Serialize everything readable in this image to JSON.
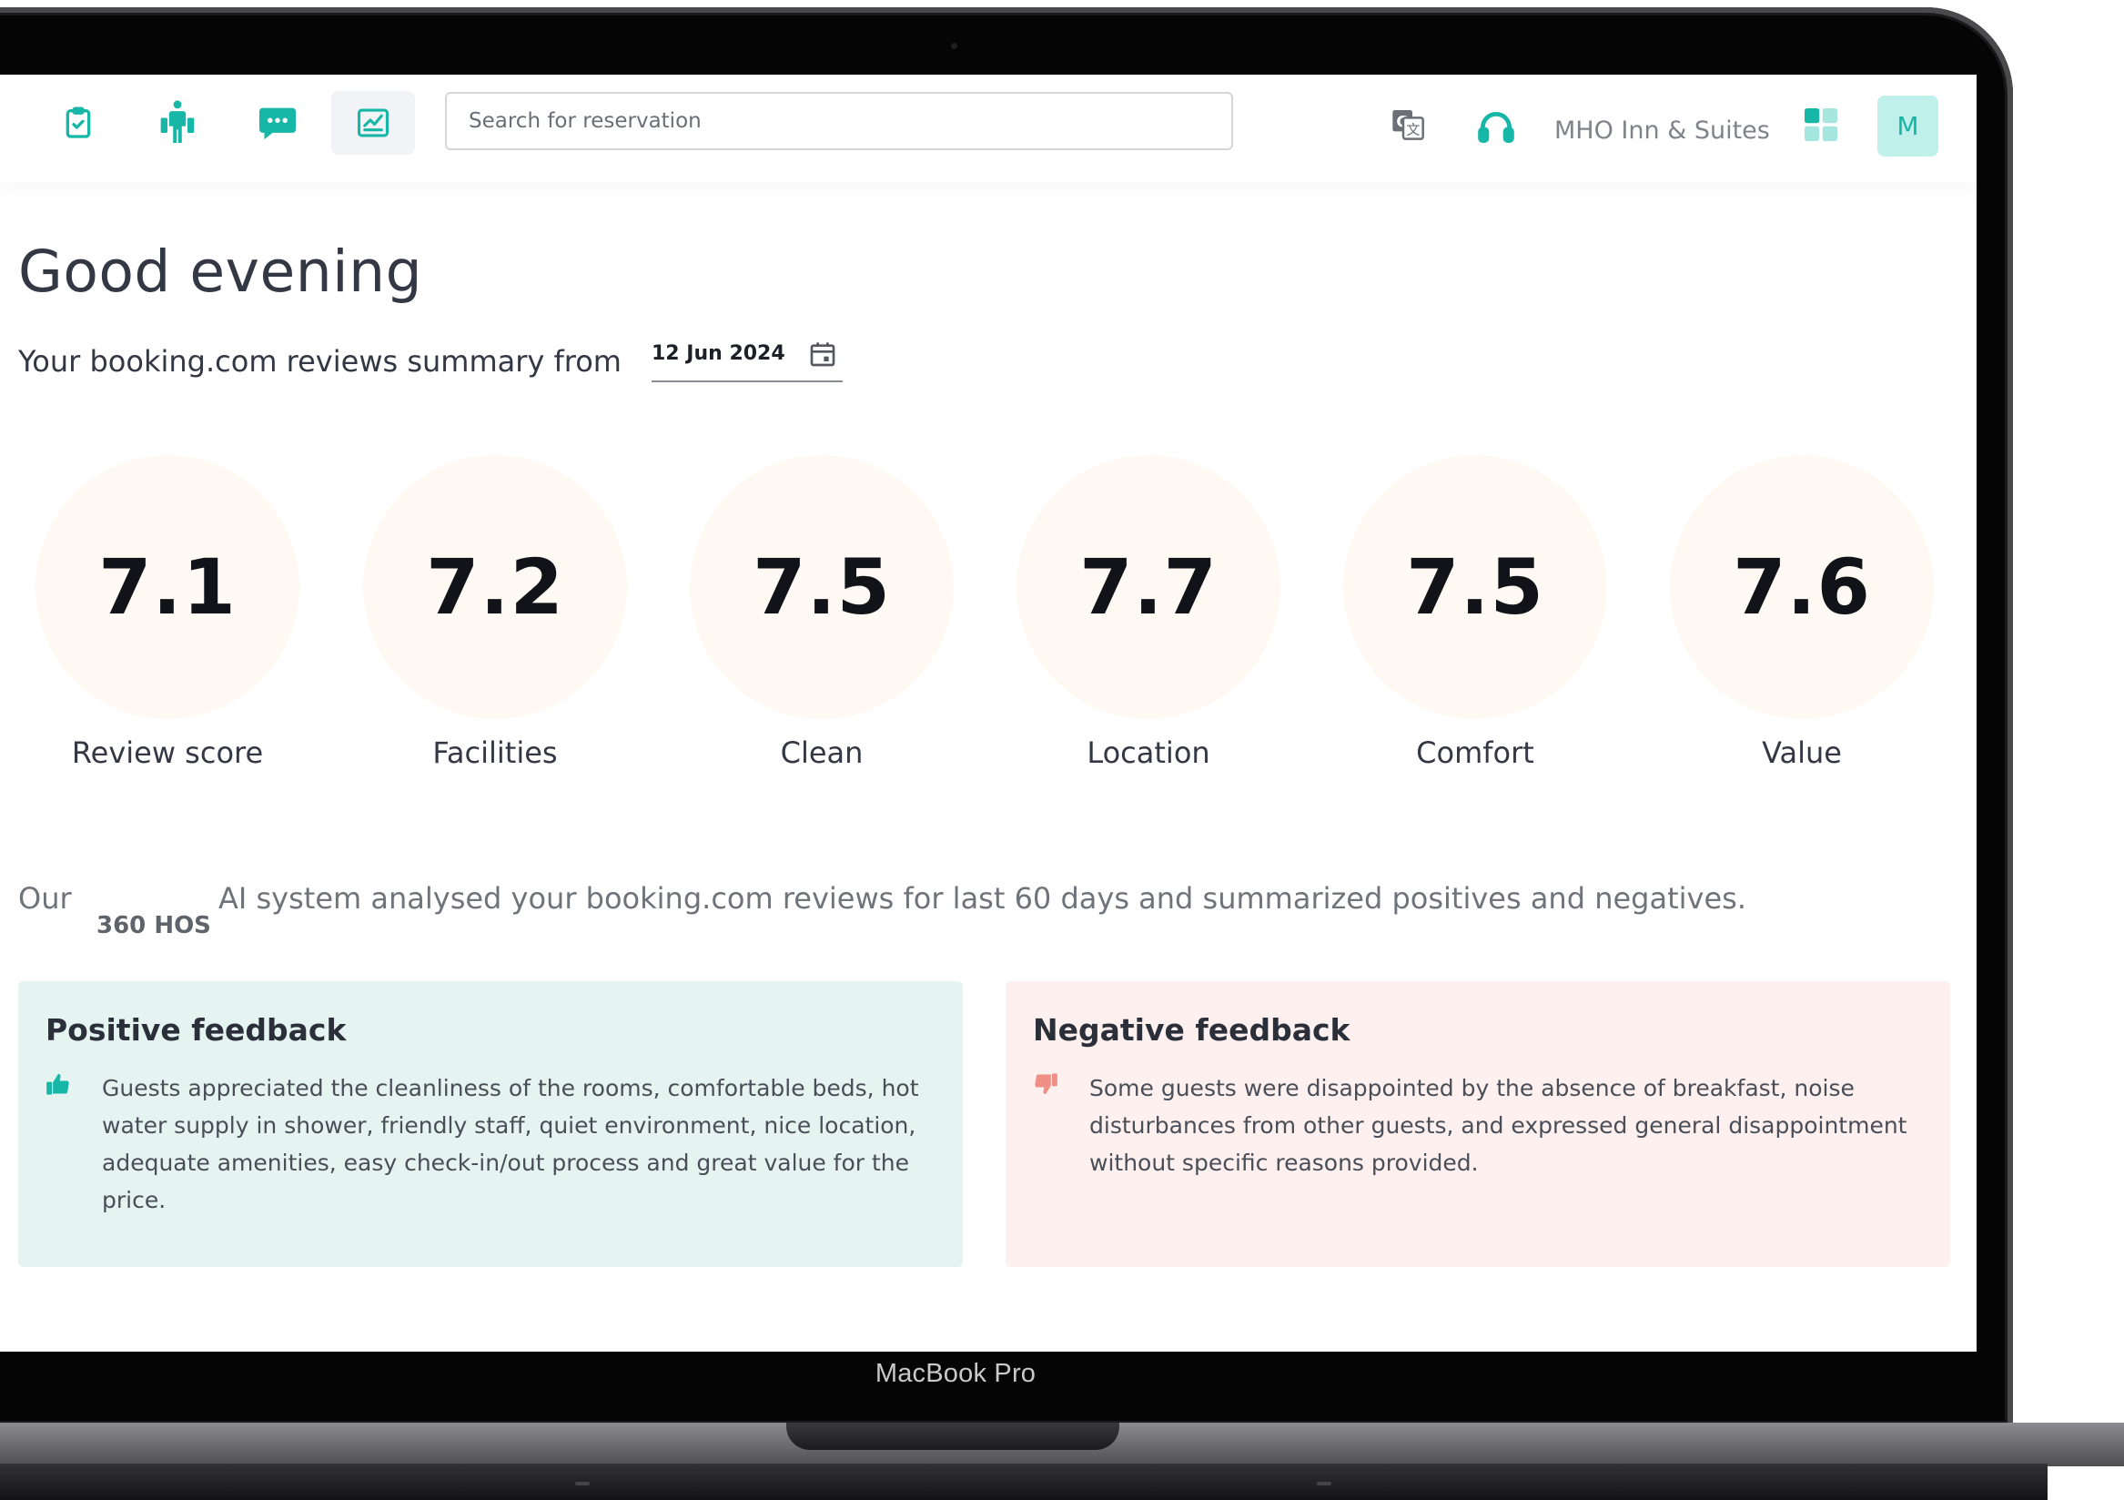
{
  "nav": {
    "icons": [
      "clipboard-check-icon",
      "luggage-porter-icon",
      "chat-icon",
      "reviews-chart-icon"
    ],
    "active_index": 3
  },
  "search": {
    "placeholder": "Search for reservation",
    "value": ""
  },
  "header": {
    "hotel_name": "MHO Inn & Suites",
    "avatar_initial": "M"
  },
  "greeting": "Good evening",
  "summary": {
    "label": "Your booking.com reviews summary from",
    "date": "12 Jun 2024"
  },
  "scores": [
    {
      "value": "7.1",
      "label": "Review score"
    },
    {
      "value": "7.2",
      "label": "Facilities"
    },
    {
      "value": "7.5",
      "label": "Clean"
    },
    {
      "value": "7.7",
      "label": "Location"
    },
    {
      "value": "7.5",
      "label": "Comfort"
    },
    {
      "value": "7.6",
      "label": "Value"
    }
  ],
  "ai_note": {
    "prefix": "Our",
    "brand": "360 HOS",
    "text": "AI system analysed your booking.com reviews for last 60 days and summarized positives and negatives."
  },
  "positive": {
    "title": "Positive feedback",
    "text": "Guests appreciated the cleanliness of the rooms, comfortable beds, hot water supply in shower, friendly staff, quiet environment, nice location, adequate amenities, easy check-in/out process and great value for the price."
  },
  "negative": {
    "title": "Negative feedback",
    "text": "Some guests were disappointed by the absence of breakfast, noise disturbances from other guests, and expressed general disappointment without specific reasons provided."
  },
  "device_label": "MacBook Pro",
  "colors": {
    "accent": "#16b7a6",
    "positive_bg": "#e5f4f0",
    "negative_bg": "#fdf0ee",
    "negative_icon": "#ef8f86",
    "score_circle": "#fefaf3"
  }
}
